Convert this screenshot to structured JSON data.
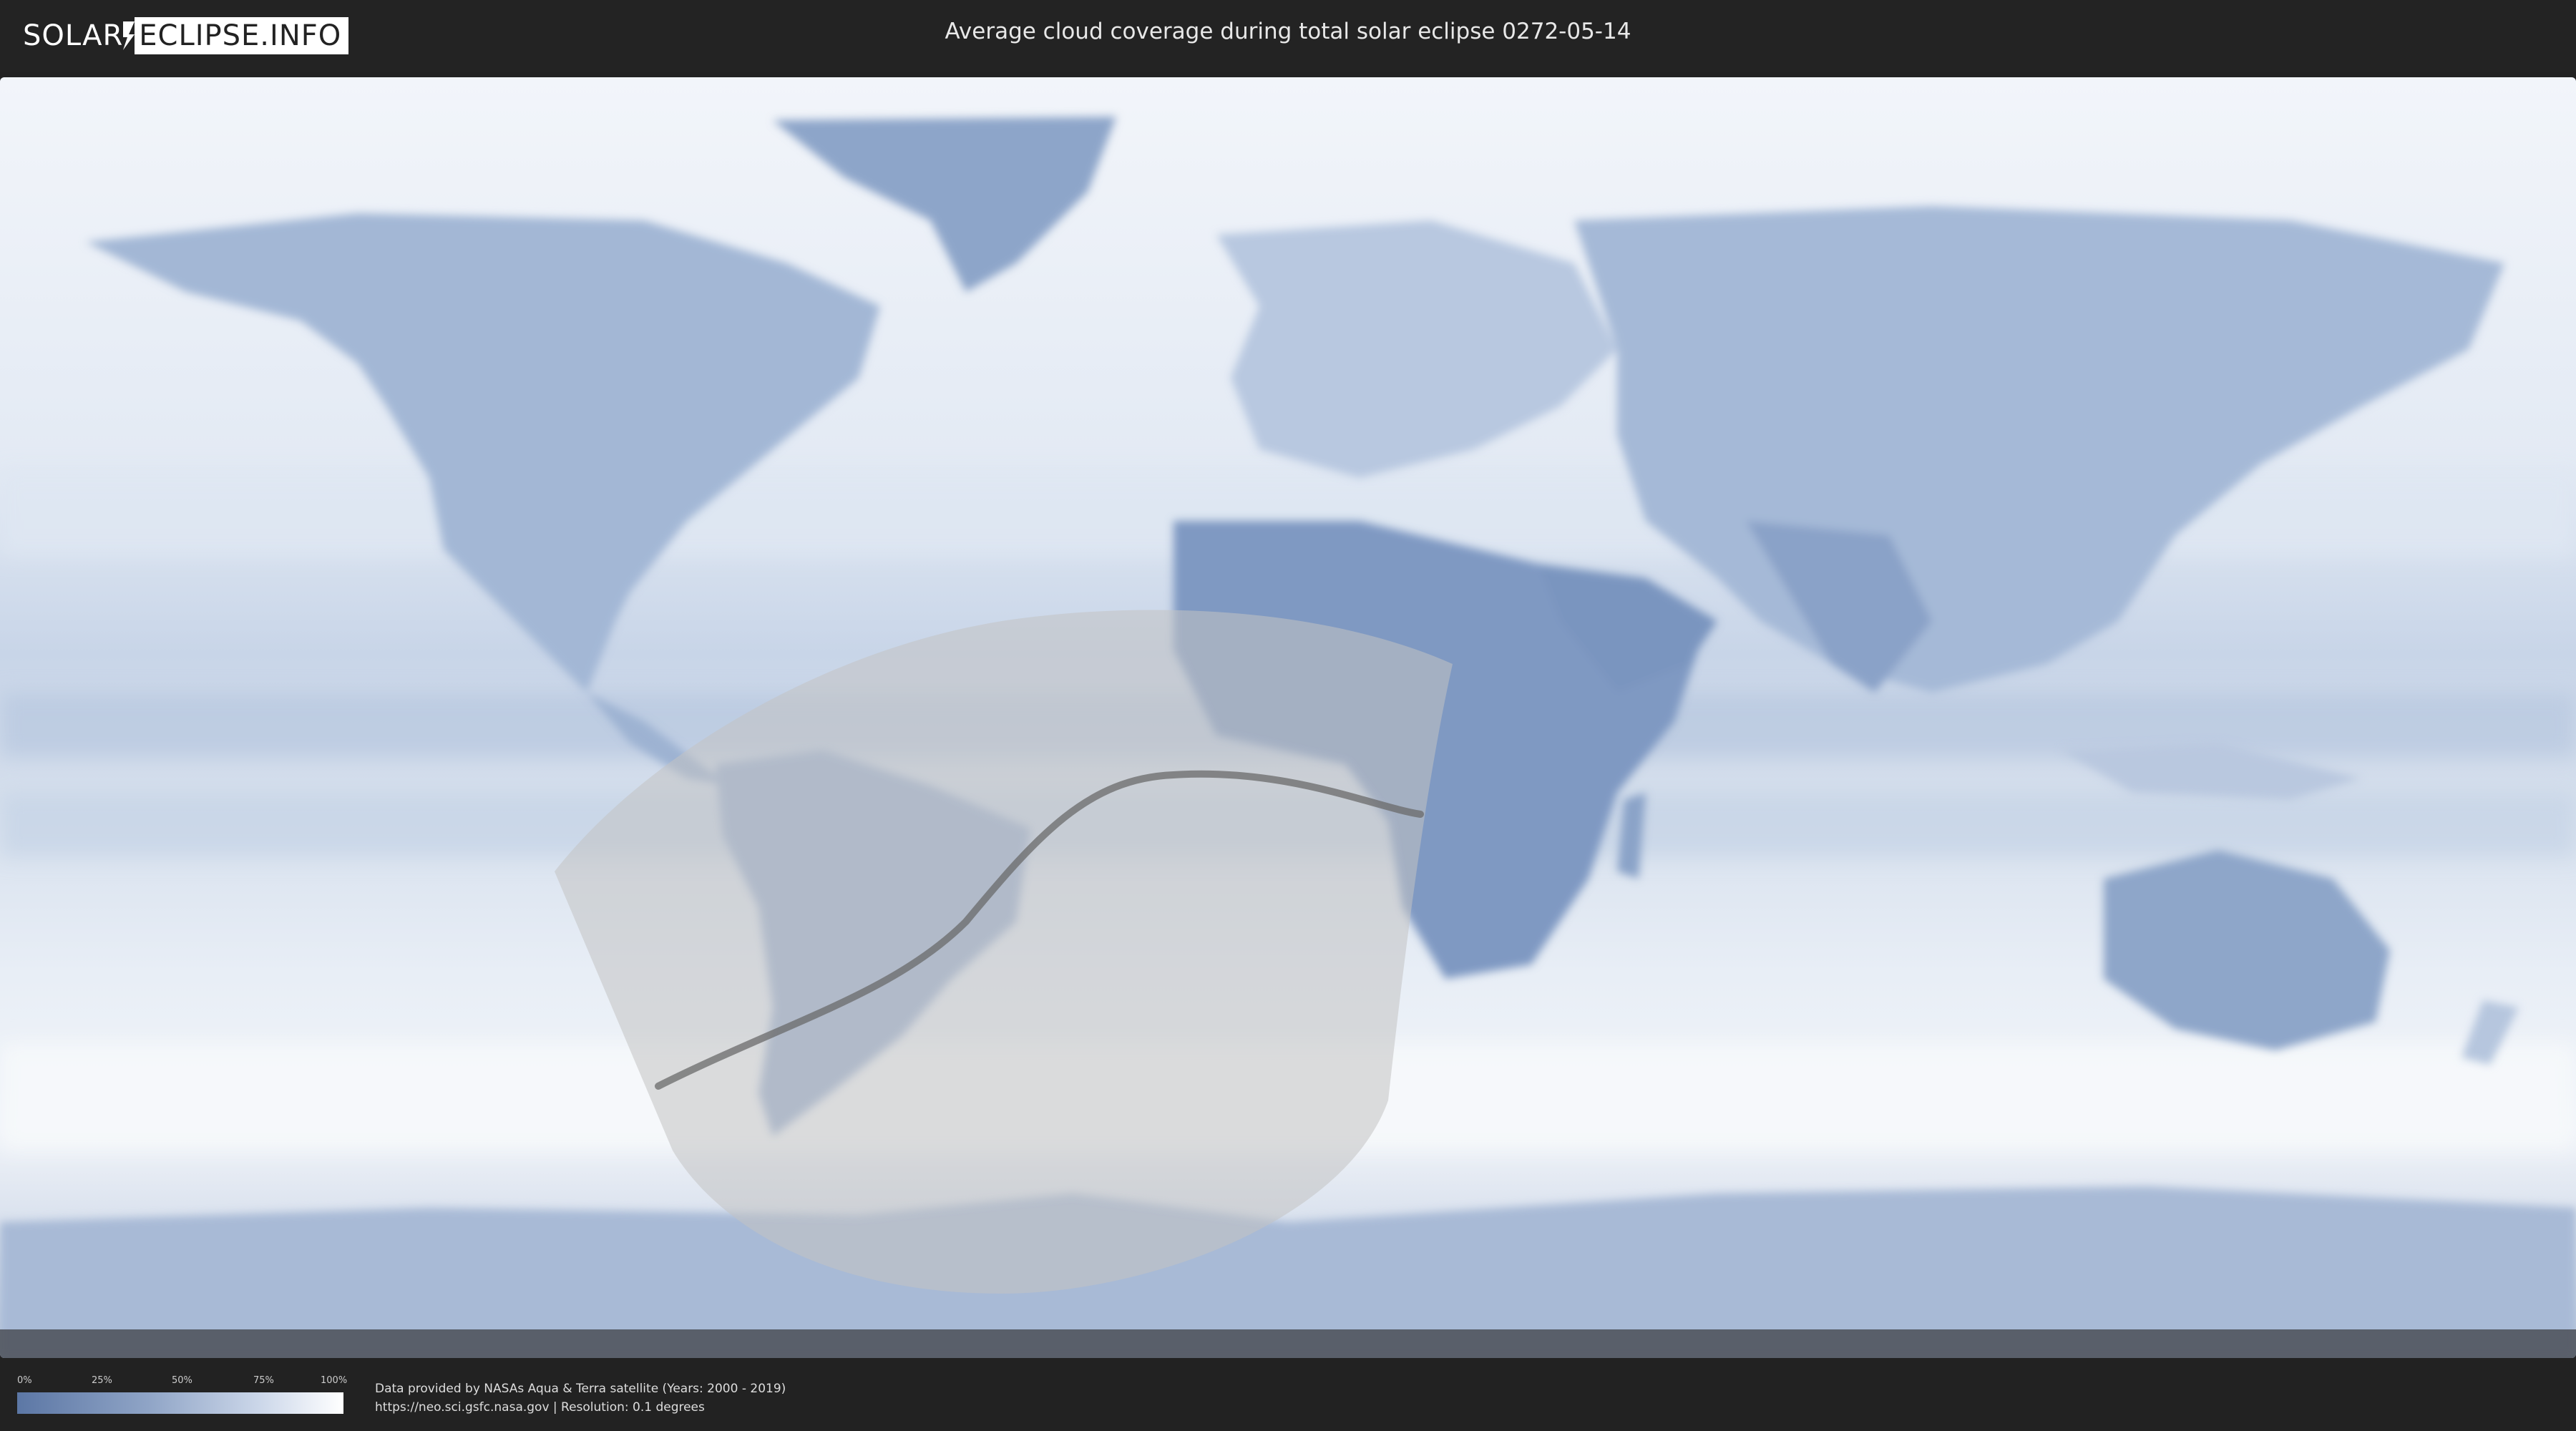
{
  "header": {
    "logo_left": "SOLAR",
    "logo_right": "ECLIPSE.INFO",
    "title": "Average cloud coverage during total solar eclipse 0272-05-14"
  },
  "legend": {
    "ticks": [
      "0%",
      "25%",
      "50%",
      "75%",
      "100%"
    ],
    "colors": {
      "low": "#5c77a5",
      "high": "#ffffff"
    }
  },
  "credits": {
    "line1": "Data provided by NASAs Aqua & Terra satellite (Years: 2000 - 2019)",
    "line2": "https://neo.sci.gsfc.nasa.gov | Resolution: 0.1 degrees"
  },
  "colors": {
    "ocean_cloud": "#e9eef6",
    "land_clear": "#7f99c2",
    "eclipse_zone": "#b8b8b8",
    "totality_path": "#666666"
  }
}
